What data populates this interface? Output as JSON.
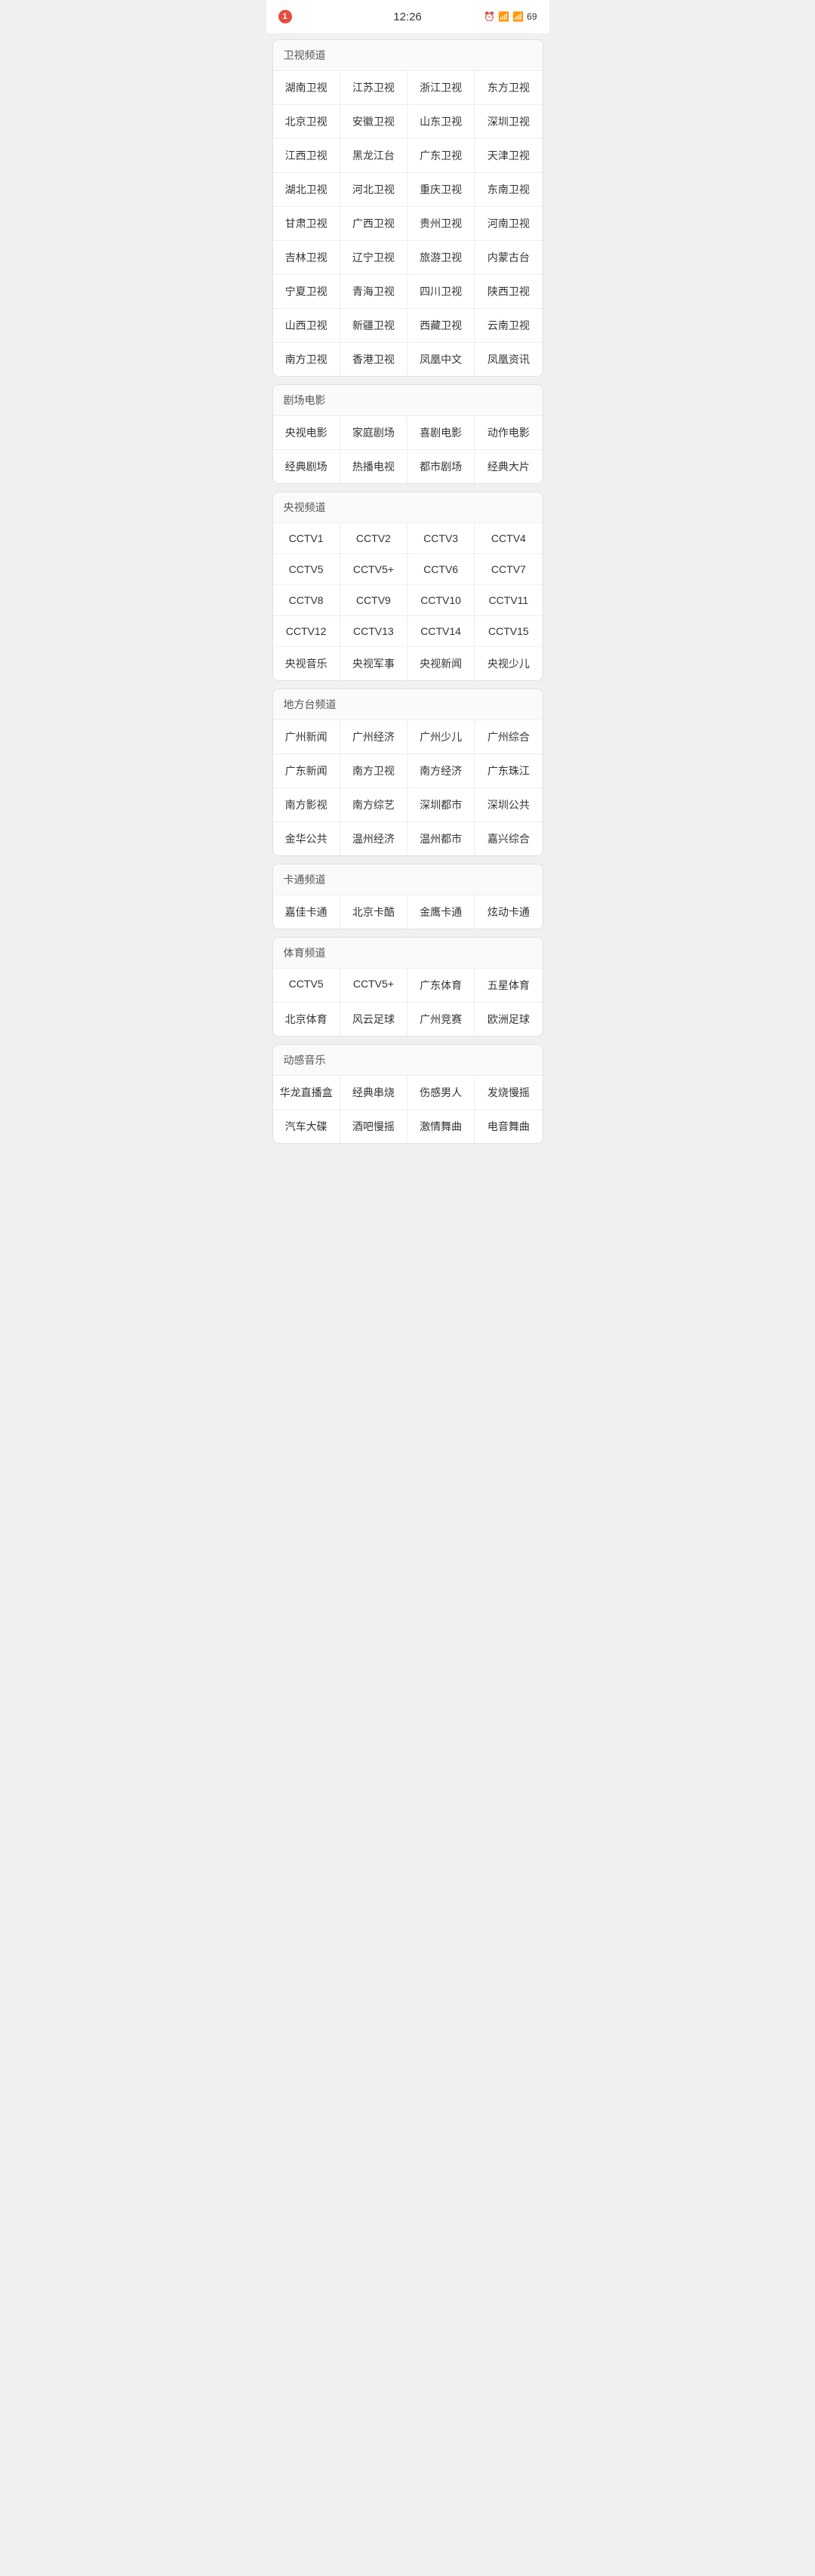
{
  "statusBar": {
    "time": "12:26",
    "notification": "1",
    "battery": "69"
  },
  "sections": [
    {
      "id": "satellite",
      "title": "卫视频道",
      "items": [
        "湖南卫视",
        "江苏卫视",
        "浙江卫视",
        "东方卫视",
        "北京卫视",
        "安徽卫视",
        "山东卫视",
        "深圳卫视",
        "江西卫视",
        "黑龙江台",
        "广东卫视",
        "天津卫视",
        "湖北卫视",
        "河北卫视",
        "重庆卫视",
        "东南卫视",
        "甘肃卫视",
        "广西卫视",
        "贵州卫视",
        "河南卫视",
        "吉林卫视",
        "辽宁卫视",
        "旅游卫视",
        "内蒙古台",
        "宁夏卫视",
        "青海卫视",
        "四川卫视",
        "陕西卫视",
        "山西卫视",
        "新疆卫视",
        "西藏卫视",
        "云南卫视",
        "南方卫视",
        "香港卫视",
        "凤凰中文",
        "凤凰资讯"
      ]
    },
    {
      "id": "drama-movie",
      "title": "剧场电影",
      "items": [
        "央视电影",
        "家庭剧场",
        "喜剧电影",
        "动作电影",
        "经典剧场",
        "热播电视",
        "都市剧场",
        "经典大片"
      ]
    },
    {
      "id": "cctv",
      "title": "央视频道",
      "items": [
        "CCTV1",
        "CCTV2",
        "CCTV3",
        "CCTV4",
        "CCTV5",
        "CCTV5+",
        "CCTV6",
        "CCTV7",
        "CCTV8",
        "CCTV9",
        "CCTV10",
        "CCTV11",
        "CCTV12",
        "CCTV13",
        "CCTV14",
        "CCTV15",
        "央视音乐",
        "央视军事",
        "央视新闻",
        "央视少儿"
      ]
    },
    {
      "id": "local",
      "title": "地方台频道",
      "items": [
        "广州新闻",
        "广州经济",
        "广州少儿",
        "广州综合",
        "广东新闻",
        "南方卫视",
        "南方经济",
        "广东珠江",
        "南方影视",
        "南方综艺",
        "深圳都市",
        "深圳公共",
        "金华公共",
        "温州经济",
        "温州都市",
        "嘉兴综合"
      ]
    },
    {
      "id": "cartoon",
      "title": "卡通频道",
      "items": [
        "嘉佳卡通",
        "北京卡酷",
        "金鹰卡通",
        "炫动卡通"
      ]
    },
    {
      "id": "sports",
      "title": "体育频道",
      "items": [
        "CCTV5",
        "CCTV5+",
        "广东体育",
        "五星体育",
        "北京体育",
        "风云足球",
        "广州竞赛",
        "欧洲足球"
      ]
    },
    {
      "id": "music",
      "title": "动感音乐",
      "items": [
        "华龙直播盒",
        "经典串烧",
        "伤感男人",
        "发烧慢摇",
        "汽车大碟",
        "酒吧慢摇",
        "激情舞曲",
        "电音舞曲"
      ]
    }
  ]
}
